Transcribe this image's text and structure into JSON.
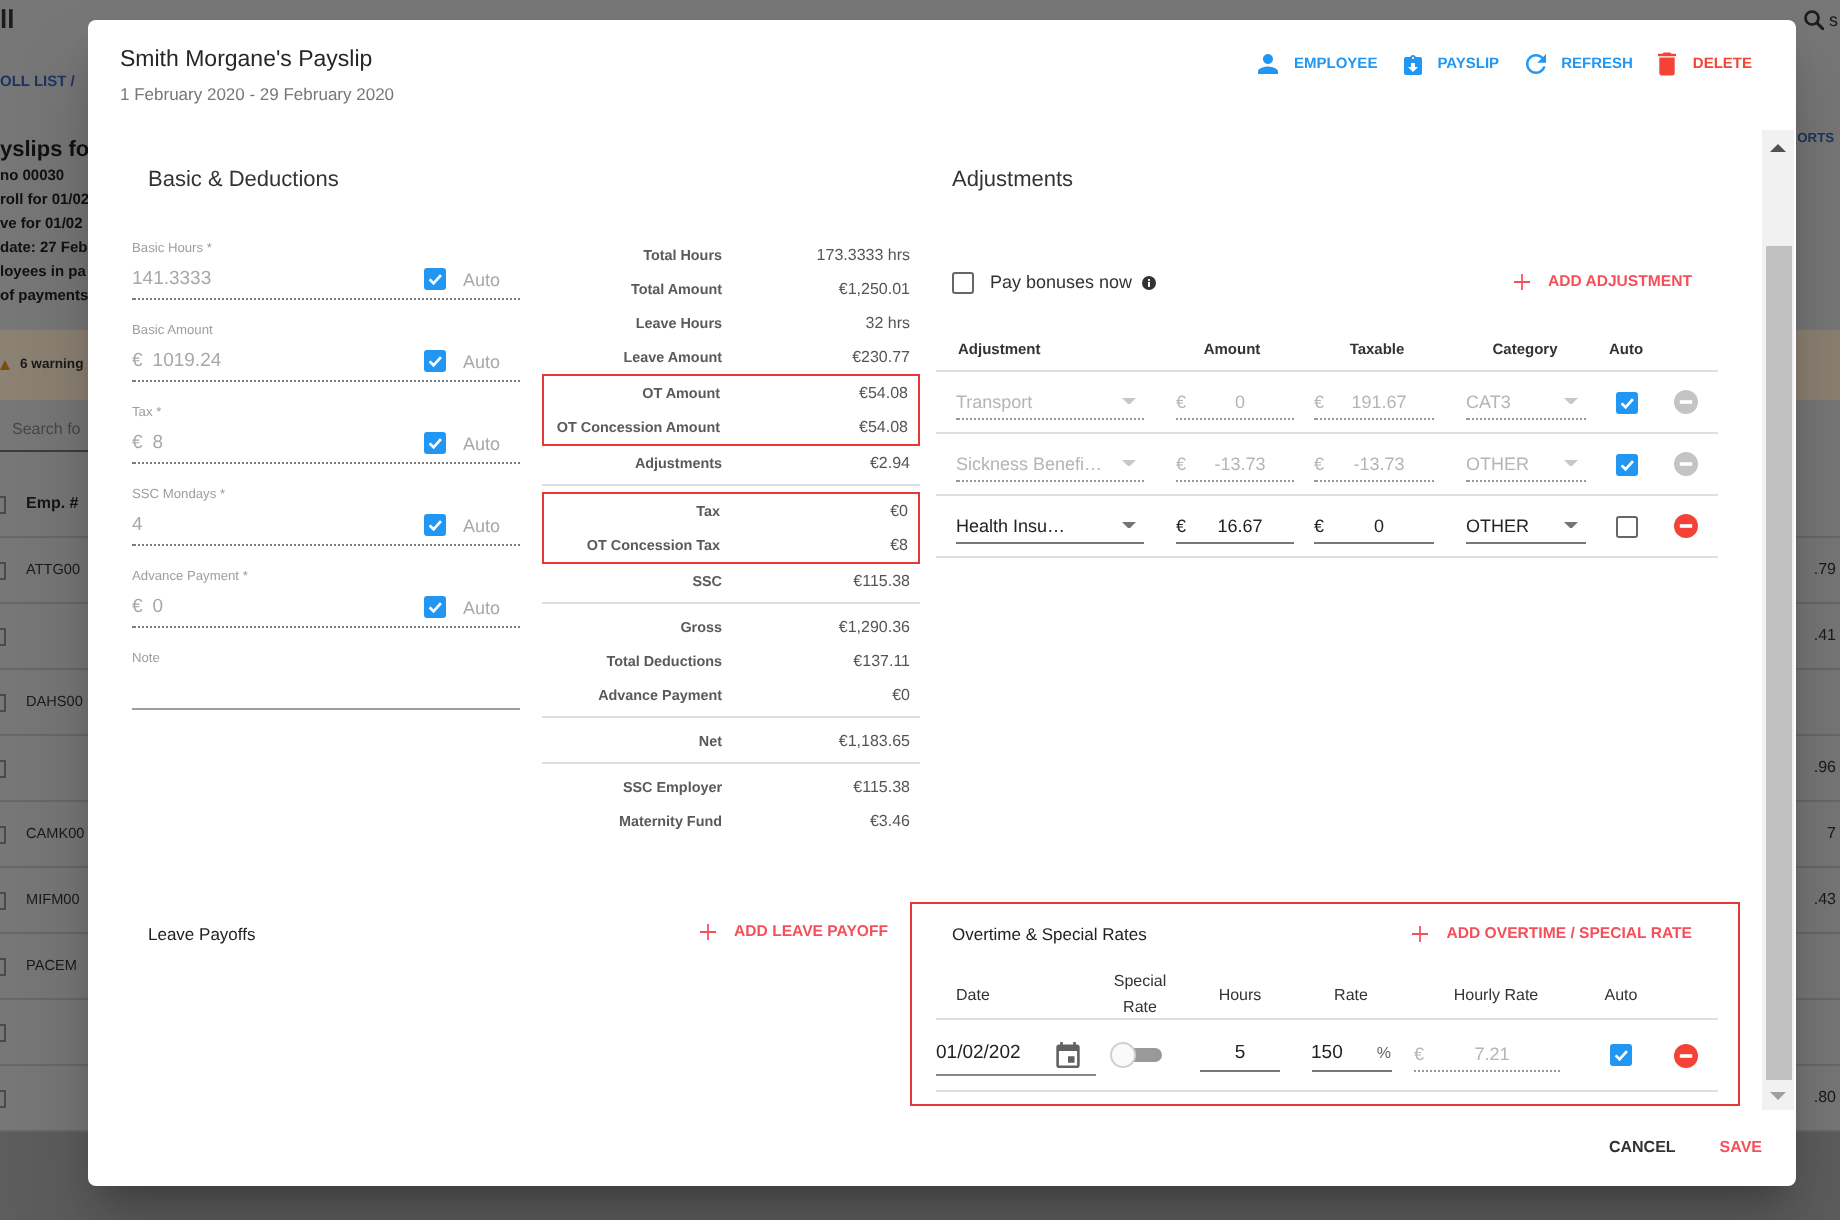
{
  "background_page": {
    "app_title": "ll",
    "toolbar_text": "s",
    "breadcrumb": "OLL LIST /",
    "heading": "yslips fo",
    "reports_button": "ORTS",
    "info_lines": [
      "no 00030",
      "roll for 01/02",
      "ve for 01/02",
      "date: 27 Feb",
      "loyees in pa",
      "of payments"
    ],
    "warning": "6 warning",
    "search": {
      "placeholder": "Search fo"
    },
    "table": {
      "columns": [
        "Emp. #"
      ],
      "all_checked": false,
      "rows": [
        {
          "checked": false,
          "emp": "ATTG00",
          "amount": ".79"
        },
        {
          "checked": false,
          "amount": ".41"
        },
        {
          "checked": false,
          "emp": "DAHS00"
        },
        {
          "checked": false,
          "amount": ".96"
        },
        {
          "checked": false,
          "emp": "CAMK00",
          "amount": "7"
        },
        {
          "checked": false,
          "emp": "MIFM00",
          "amount": ".43"
        },
        {
          "checked": false,
          "emp": "PACEM"
        },
        {
          "checked": false
        },
        {
          "checked": false,
          "amount": ".80"
        }
      ]
    }
  },
  "dialog": {
    "title": "Smith Morgane's Payslip",
    "period": "1 February 2020 - 29 February 2020",
    "actions": [
      {
        "kind": "employee",
        "label": "EMPLOYEE"
      },
      {
        "kind": "payslip",
        "label": "PAYSLIP"
      },
      {
        "kind": "refresh",
        "label": "REFRESH"
      },
      {
        "kind": "delete",
        "label": "DELETE"
      }
    ]
  },
  "basic_deductions": {
    "title": "Basic & Deductions",
    "fields": [
      {
        "label": "Basic Hours *",
        "value": "141.3333",
        "auto": true,
        "auto_label": "Auto"
      },
      {
        "label": "Basic Amount",
        "prefix": "€",
        "value": "1019.24",
        "auto": true,
        "auto_label": "Auto"
      },
      {
        "label": "Tax *",
        "prefix": "€",
        "value": "8",
        "auto": true,
        "auto_label": "Auto"
      },
      {
        "label": "SSC Mondays *",
        "value": "4",
        "auto": true,
        "auto_label": "Auto"
      },
      {
        "label": "Advance Payment *",
        "prefix": "€",
        "value": "0",
        "auto": true,
        "auto_label": "Auto"
      }
    ],
    "note": {
      "label": "Note"
    },
    "summary": {
      "sections": [
        {
          "blocks": [
            {
              "highlighted": false,
              "rows": [
                {
                  "label": "Total Hours",
                  "value": "173.3333 hrs"
                },
                {
                  "label": "Total Amount",
                  "value": "€1,250.01"
                },
                {
                  "label": "Leave Hours",
                  "value": "32 hrs"
                },
                {
                  "label": "Leave Amount",
                  "value": "€230.77"
                }
              ]
            },
            {
              "highlighted": true,
              "rows": [
                {
                  "label": "OT Amount",
                  "value": "€54.08"
                },
                {
                  "label": "OT Concession Amount",
                  "value": "€54.08"
                }
              ]
            },
            {
              "highlighted": false,
              "rows": [
                {
                  "label": "Adjustments",
                  "value": "€2.94"
                }
              ]
            }
          ]
        },
        {
          "blocks": [
            {
              "highlighted": true,
              "rows": [
                {
                  "label": "Tax",
                  "value": "€0"
                },
                {
                  "label": "OT Concession Tax",
                  "value": "€8"
                }
              ]
            },
            {
              "highlighted": false,
              "rows": [
                {
                  "label": "SSC",
                  "value": "€115.38"
                }
              ]
            }
          ]
        },
        {
          "blocks": [
            {
              "highlighted": false,
              "rows": [
                {
                  "label": "Gross",
                  "value": "€1,290.36"
                },
                {
                  "label": "Total Deductions",
                  "value": "€137.11"
                },
                {
                  "label": "Advance Payment",
                  "value": "€0"
                }
              ]
            }
          ]
        },
        {
          "blocks": [
            {
              "highlighted": false,
              "rows": [
                {
                  "label": "Net",
                  "value": "€1,183.65"
                }
              ]
            }
          ]
        },
        {
          "blocks": [
            {
              "highlighted": false,
              "rows": [
                {
                  "label": "SSC Employer",
                  "value": "€115.38"
                },
                {
                  "label": "Maternity Fund",
                  "value": "€3.46"
                }
              ]
            }
          ]
        }
      ]
    }
  },
  "adjustments": {
    "title": "Adjustments",
    "pay_bonuses": {
      "label": "Pay bonuses now",
      "checked": false
    },
    "add_button": "ADD ADJUSTMENT",
    "columns": [
      "Adjustment",
      "Amount",
      "Taxable",
      "Category",
      "Auto"
    ],
    "rows": [
      {
        "adjustment": "Transport",
        "amount_currency": "€",
        "amount": "0",
        "taxable_currency": "€",
        "taxable": "191.67",
        "category": "CAT3",
        "auto": true
      },
      {
        "adjustment": "Sickness Benefi…",
        "amount_currency": "€",
        "amount": "-13.73",
        "taxable_currency": "€",
        "taxable": "-13.73",
        "category": "OTHER",
        "auto": true
      },
      {
        "adjustment": "Health Insu…",
        "amount_currency": "€",
        "amount": "16.67",
        "taxable_currency": "€",
        "taxable": "0",
        "category": "OTHER",
        "auto": false
      }
    ]
  },
  "leave_payoffs": {
    "title": "Leave Payoffs",
    "add_button": "ADD LEAVE PAYOFF"
  },
  "overtime": {
    "title": "Overtime & Special Rates",
    "add_button": "ADD OVERTIME / SPECIAL RATE",
    "highlighted": true,
    "columns": [
      "Date",
      "Special Rate",
      "Hours",
      "Rate",
      "Hourly Rate",
      "Auto"
    ],
    "rows": [
      {
        "date": "01/02/202",
        "special_rate": false,
        "hours": "5",
        "rate": "150",
        "rate_unit": "%",
        "currency": "€",
        "hourly_rate": "7.21",
        "auto": true
      }
    ]
  },
  "footer": {
    "buttons": [
      {
        "kind": "cancel",
        "label": "CANCEL"
      },
      {
        "kind": "save",
        "label": "SAVE"
      }
    ]
  }
}
